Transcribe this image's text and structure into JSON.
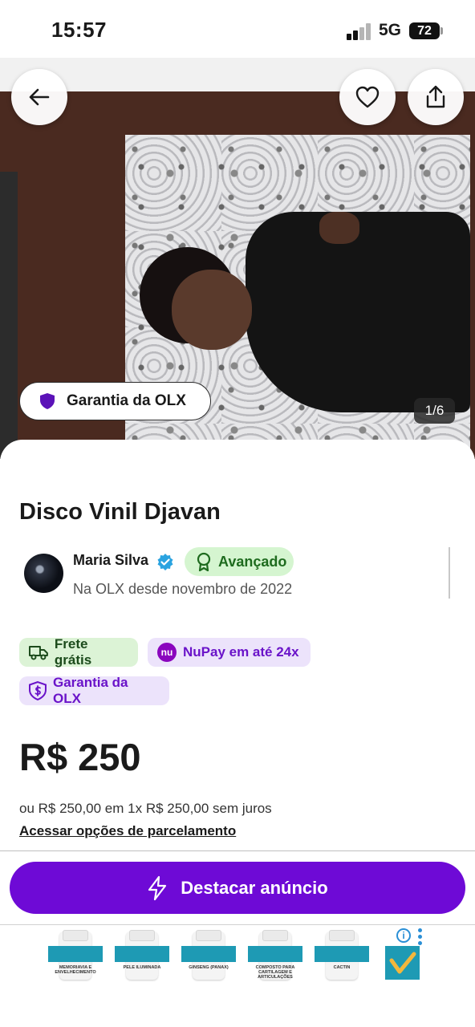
{
  "status_bar": {
    "time": "15:57",
    "network": "5G",
    "battery": "72"
  },
  "gallery": {
    "counter": "1/6",
    "guarantee_label": "Garantia da OLX"
  },
  "listing": {
    "title": "Disco Vinil Djavan",
    "seller": {
      "name": "Maria Silva",
      "level": "Avançado",
      "member_since": "Na OLX desde novembro de 2022"
    },
    "badges": [
      {
        "label": "Frete grátis",
        "icon": "truck-icon"
      },
      {
        "label": "NuPay em até 24x",
        "icon": "nubank-logo-icon",
        "logo_text": "nu"
      },
      {
        "label": "Garantia da OLX",
        "icon": "shield-money-icon"
      }
    ],
    "price": "R$ 250",
    "installment_text": "ou R$ 250,00 em 1x R$ 250,00 sem juros",
    "installment_link": "Acessar opções de parcelamento"
  },
  "cta": {
    "label": "Destacar anúncio",
    "icon": "lightning-icon"
  },
  "ad": {
    "info_symbol": "i",
    "products": [
      {
        "name": "MEMORIAVIA E ENVELHECIMENTO"
      },
      {
        "name": "PELE ILUMINADA"
      },
      {
        "name": "GINSENG (PANAX)"
      },
      {
        "name": "COMPOSTO PARA CARTILAGEM E ARTICULAÇÕES"
      },
      {
        "name": "CACTIN"
      }
    ]
  },
  "colors": {
    "brand_purple": "#6e0ad6",
    "badge_green_bg": "#d5f5d0",
    "badge_purple_bg": "#ece3fb",
    "verified_blue": "#2aa3e0"
  }
}
